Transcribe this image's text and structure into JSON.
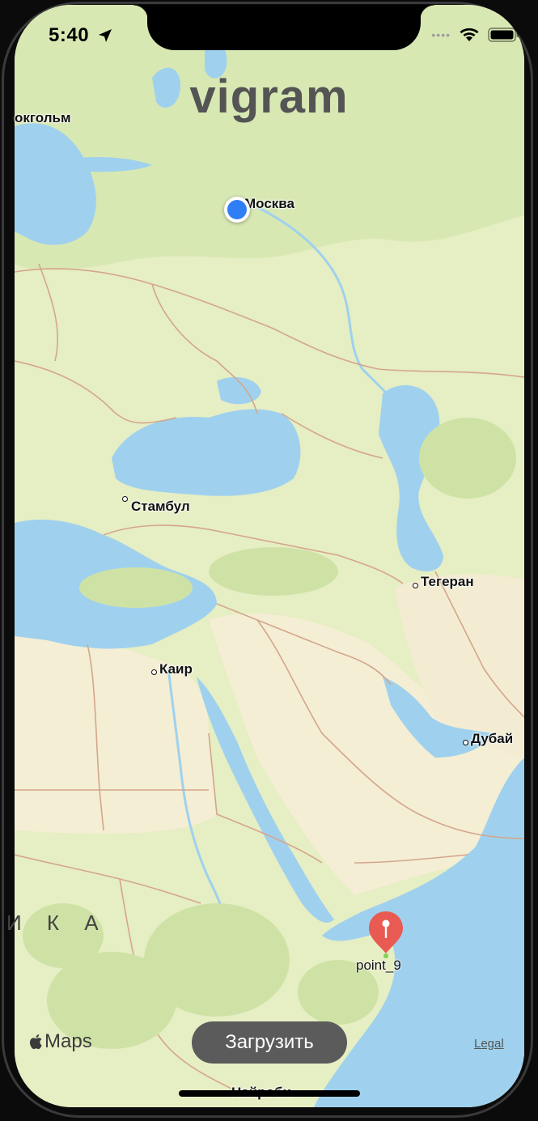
{
  "status_bar": {
    "time": "5:40"
  },
  "app": {
    "title": "vigram"
  },
  "map": {
    "cities": [
      {
        "id": "stockholm",
        "label": "окгольм"
      },
      {
        "id": "moscow",
        "label": "Москва"
      },
      {
        "id": "istanbul",
        "label": "Стамбул"
      },
      {
        "id": "tehran",
        "label": "Тегеран"
      },
      {
        "id": "cairo",
        "label": "Каир"
      },
      {
        "id": "dubai",
        "label": "Дубай"
      },
      {
        "id": "nairobi",
        "label": "Найроби"
      }
    ],
    "region_label": "И К А",
    "pin": {
      "label": "point_9",
      "color": "#e85a52"
    },
    "user_location_color": "#2f7ef6",
    "attribution": {
      "logo_text": "Maps",
      "legal": "Legal"
    }
  },
  "actions": {
    "load_button": "Загрузить"
  },
  "colors": {
    "land": "#eaf0c7",
    "water": "#9fd1ee",
    "desert": "#f5efd6",
    "border": "#d6a98a",
    "button_bg": "#5b5b5b"
  }
}
